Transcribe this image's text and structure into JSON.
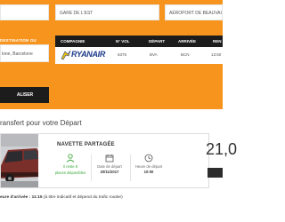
{
  "search": {
    "field1": "",
    "from": "GARE DE L'EST",
    "to": "AÉROPORT DE BEAUVAIS",
    "destination_label": "DESTINATION OU",
    "destination_value": "lone, Barcelone",
    "validate_label": "ALISER"
  },
  "flight": {
    "headers": [
      "COMPAGNIE",
      "N° VOL",
      "DÉPART",
      "ARRIVÉE",
      "REN"
    ],
    "airline": "RYANAIR",
    "number": "6375",
    "departure": "BVA",
    "arrival": "BCN",
    "time": "13:50"
  },
  "transfer": {
    "section_title": "ransfert pour votre Départ",
    "title": "NAVETTE PARTAGÉE",
    "seats_line1": "Il reste 8",
    "seats_line2": "places disponibles",
    "date_label": "Date de départ",
    "date_value": "20/11/2017",
    "time_label": "Heure de départ",
    "time_value": "10:00",
    "price": "21,0",
    "arrival_prefix": "eure d'arrivée :",
    "arrival_time": "11:15",
    "arrival_note": "(à titre indicatif et dépend du trafic routier)"
  },
  "colors": {
    "accent": "#f7941d",
    "dark": "#1c1c1c",
    "green": "#39a939",
    "ryanair": "#1b3a8a"
  },
  "icons": [
    "users-icon",
    "calendar-icon",
    "clock-icon",
    "ryanair-harp-logo"
  ]
}
